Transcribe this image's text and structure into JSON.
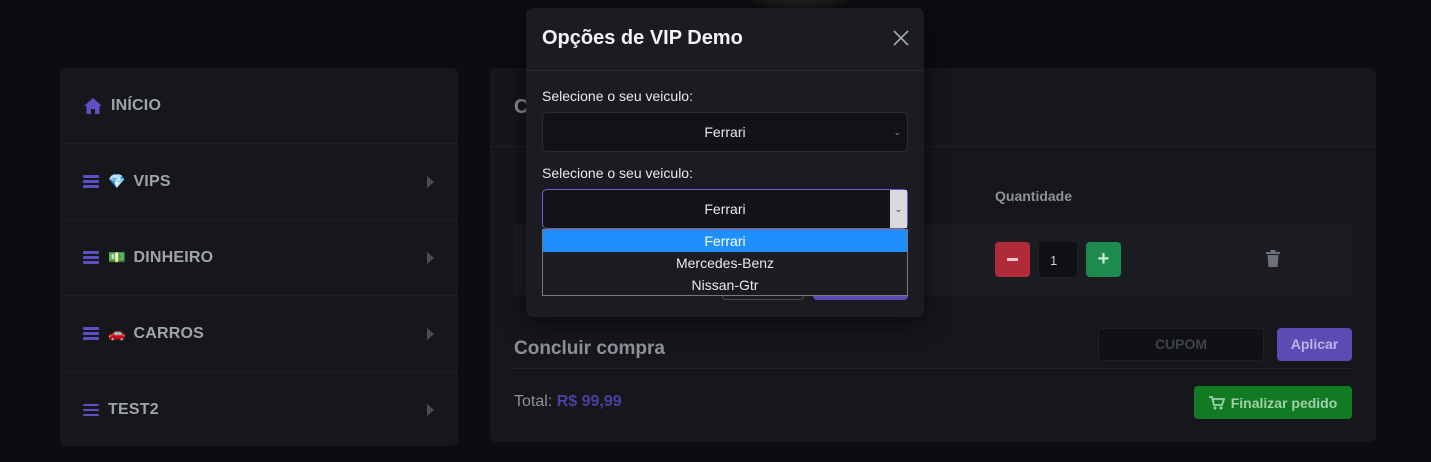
{
  "sidebar": {
    "items": [
      {
        "label": "INÍCIO",
        "icon": "home-icon"
      },
      {
        "label": "VIPS",
        "icon": "diamond-icon",
        "emoji": "💎"
      },
      {
        "label": "DINHEIRO",
        "icon": "money-icon",
        "emoji": "💵"
      },
      {
        "label": "CARROS",
        "icon": "car-icon",
        "emoji": "🚗"
      },
      {
        "label": "TEST2",
        "icon": "menu-icon"
      }
    ]
  },
  "cart": {
    "heading": "C",
    "qty_header": "Quantidade",
    "quantity": "1",
    "concluir": "Concluir compra",
    "cupom_placeholder": "CUPOM",
    "aplicar": "Aplicar",
    "total_label": "Total:",
    "total_value": "R$ 99,99",
    "finalizar": "Finalizar pedido"
  },
  "modal": {
    "title": "Opções de VIP Demo",
    "field1_label": "Selecione o seu veiculo:",
    "field1_value": "Ferrari",
    "field2_label": "Selecione o seu veiculo:",
    "field2_value": "Ferrari",
    "options": [
      "Ferrari",
      "Mercedes-Benz",
      "Nissan-Gtr"
    ]
  },
  "colors": {
    "accent": "#5b4bb5",
    "danger": "#b02a37",
    "success": "#1d8a4e",
    "dropdown_selected": "#1e8fff"
  }
}
